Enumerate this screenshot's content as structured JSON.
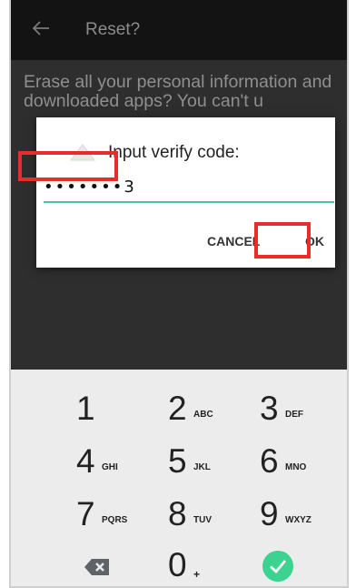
{
  "app_bar": {
    "title": "Reset?"
  },
  "message": "Erase all your personal information and downloaded apps? You can't u",
  "dialog": {
    "title": "Input verify code:",
    "code_value": "•••••••3",
    "cancel_label": "CANCEL",
    "ok_label": "OK"
  },
  "keypad": {
    "keys": [
      {
        "num": "1",
        "letters": ""
      },
      {
        "num": "2",
        "letters": "ABC"
      },
      {
        "num": "3",
        "letters": "DEF"
      },
      {
        "num": "4",
        "letters": "GHI"
      },
      {
        "num": "5",
        "letters": "JKL"
      },
      {
        "num": "6",
        "letters": "MNO"
      },
      {
        "num": "7",
        "letters": "PQRS"
      },
      {
        "num": "8",
        "letters": "TUV"
      },
      {
        "num": "9",
        "letters": "WXYZ"
      },
      {
        "num": "0",
        "letters": "+"
      }
    ]
  },
  "colors": {
    "accent": "#40c8a0",
    "highlight": "#e82c2c",
    "done_button": "#3bd38f"
  },
  "icons": {
    "back": "arrow-back-icon",
    "dialog": "warning-icon",
    "delete": "backspace-icon",
    "done": "check-icon"
  }
}
